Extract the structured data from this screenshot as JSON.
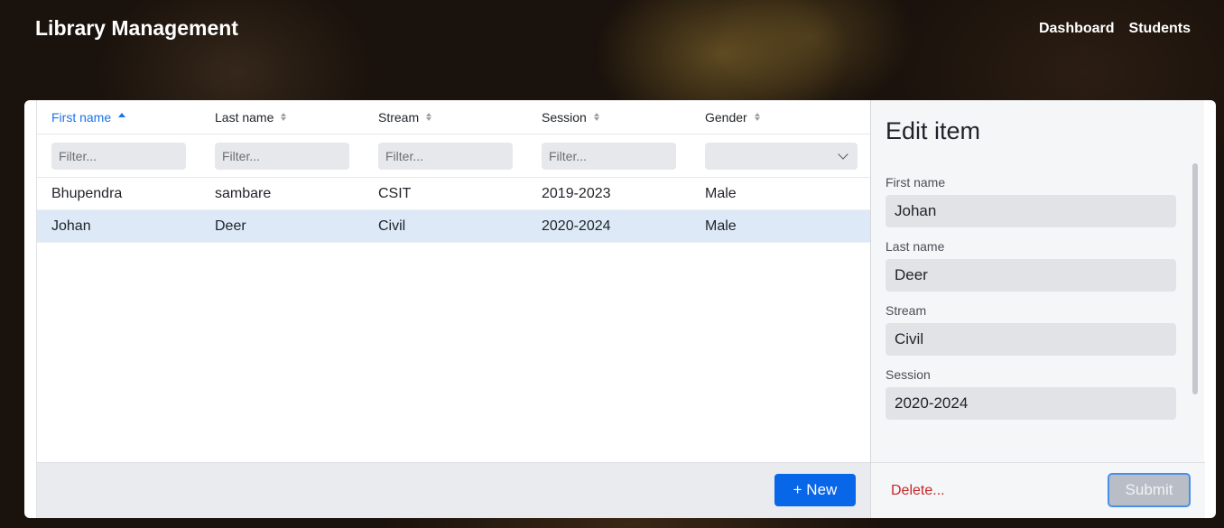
{
  "app": {
    "title": "Library Management"
  },
  "nav": {
    "items": [
      {
        "label": "Dashboard"
      },
      {
        "label": "Students"
      }
    ]
  },
  "grid": {
    "columns": [
      {
        "label": "First name",
        "sort": "asc"
      },
      {
        "label": "Last name",
        "sort": "none"
      },
      {
        "label": "Stream",
        "sort": "none"
      },
      {
        "label": "Session",
        "sort": "none"
      },
      {
        "label": "Gender",
        "sort": "none"
      }
    ],
    "filter_placeholder": "Filter...",
    "gender_filter_value": "",
    "rows": [
      {
        "first_name": "Bhupendra",
        "last_name": "sambare",
        "stream": "CSIT",
        "session": "2019-2023",
        "gender": "Male",
        "selected": false
      },
      {
        "first_name": "Johan",
        "last_name": "Deer",
        "stream": "Civil",
        "session": "2020-2024",
        "gender": "Male",
        "selected": true
      }
    ],
    "new_button": "+ New"
  },
  "editor": {
    "title": "Edit item",
    "fields": [
      {
        "label": "First name",
        "value": "Johan"
      },
      {
        "label": "Last name",
        "value": "Deer"
      },
      {
        "label": "Stream",
        "value": "Civil"
      },
      {
        "label": "Session",
        "value": "2020-2024"
      }
    ],
    "delete_label": "Delete...",
    "submit_label": "Submit"
  },
  "colors": {
    "accent": "#0866e8",
    "sort_active": "#1a73e8",
    "danger": "#c62828",
    "selected_row": "#dde9f7"
  }
}
